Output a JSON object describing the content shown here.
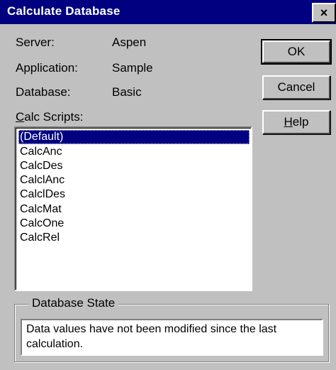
{
  "window": {
    "title": "Calculate Database",
    "close_label": "×"
  },
  "info": {
    "server_label": "Server:",
    "server_value": "Aspen",
    "application_label": "Application:",
    "application_value": "Sample",
    "database_label": "Database:",
    "database_value": "Basic"
  },
  "calc_scripts": {
    "label_mnemonic": "C",
    "label_rest": "alc Scripts:",
    "items": [
      "(Default)",
      "CalcAnc",
      "CalcDes",
      "CalclAnc",
      "CalclDes",
      "CalcMat",
      "CalcOne",
      "CalcRel"
    ],
    "selected": "(Default)"
  },
  "buttons": {
    "ok": "OK",
    "cancel": "Cancel",
    "help_mnemonic": "H",
    "help_rest": "elp"
  },
  "database_state": {
    "title": "Database State",
    "message": "Data values have not been modified since the last calculation."
  },
  "colors": {
    "titlebar": "#000080",
    "face": "#c0c0c0",
    "selection": "#000080"
  }
}
